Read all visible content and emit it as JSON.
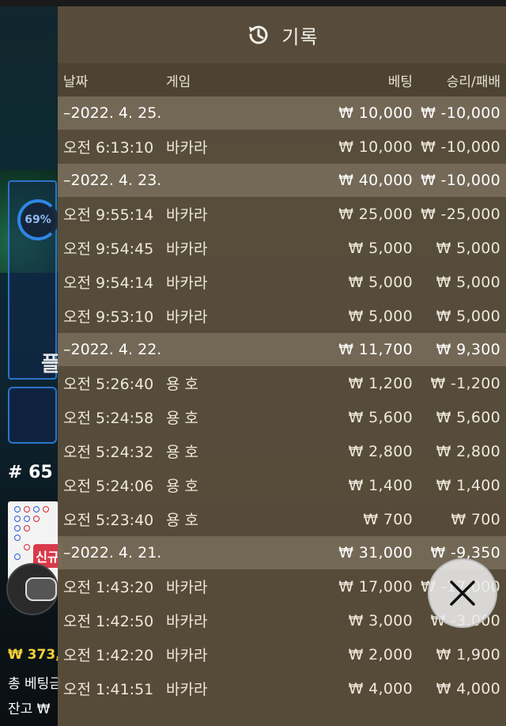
{
  "background": {
    "percent_badge": "69%",
    "side_char": "플",
    "round_label": "# 65",
    "new_tag": "신규",
    "balance": "₩ 373,",
    "total_bet_label": "총 베팅금",
    "remaining_label": "잔고 ₩"
  },
  "history": {
    "title": "기록",
    "columns": {
      "date": "날짜",
      "game": "게임",
      "bet": "베팅",
      "result": "승리/패배"
    },
    "groups": [
      {
        "date": "–2022. 4. 25.",
        "bet": "₩ 10,000",
        "result": "₩ -10,000",
        "items": [
          {
            "time": "오전 6:13:10",
            "game": "바카라",
            "bet": "₩ 10,000",
            "result": "₩ -10,000"
          }
        ]
      },
      {
        "date": "–2022. 4. 23.",
        "bet": "₩ 40,000",
        "result": "₩ -10,000",
        "items": [
          {
            "time": "오전 9:55:14",
            "game": "바카라",
            "bet": "₩ 25,000",
            "result": "₩ -25,000"
          },
          {
            "time": "오전 9:54:45",
            "game": "바카라",
            "bet": "₩ 5,000",
            "result": "₩ 5,000"
          },
          {
            "time": "오전 9:54:14",
            "game": "바카라",
            "bet": "₩ 5,000",
            "result": "₩ 5,000"
          },
          {
            "time": "오전 9:53:10",
            "game": "바카라",
            "bet": "₩ 5,000",
            "result": "₩ 5,000"
          }
        ]
      },
      {
        "date": "–2022. 4. 22.",
        "bet": "₩ 11,700",
        "result": "₩ 9,300",
        "items": [
          {
            "time": "오전 5:26:40",
            "game": "용 호",
            "bet": "₩ 1,200",
            "result": "₩ -1,200"
          },
          {
            "time": "오전 5:24:58",
            "game": "용 호",
            "bet": "₩ 5,600",
            "result": "₩ 5,600"
          },
          {
            "time": "오전 5:24:32",
            "game": "용 호",
            "bet": "₩ 2,800",
            "result": "₩ 2,800"
          },
          {
            "time": "오전 5:24:06",
            "game": "용 호",
            "bet": "₩ 1,400",
            "result": "₩ 1,400"
          },
          {
            "time": "오전 5:23:40",
            "game": "용 호",
            "bet": "₩ 700",
            "result": "₩ 700"
          }
        ]
      },
      {
        "date": "–2022. 4. 21.",
        "bet": "₩ 31,000",
        "result": "₩ -9,350",
        "items": [
          {
            "time": "오전 1:43:20",
            "game": "바카라",
            "bet": "₩ 17,000",
            "result": "₩ -17,000"
          },
          {
            "time": "오전 1:42:50",
            "game": "바카라",
            "bet": "₩ 3,000",
            "result": "₩ -3,000"
          },
          {
            "time": "오전 1:42:20",
            "game": "바카라",
            "bet": "₩ 2,000",
            "result": "₩ 1,900"
          },
          {
            "time": "오전 1:41:51",
            "game": "바카라",
            "bet": "₩ 4,000",
            "result": "₩ 4,000"
          }
        ]
      }
    ]
  },
  "close_icon": "close-icon",
  "history_icon": "history-icon"
}
